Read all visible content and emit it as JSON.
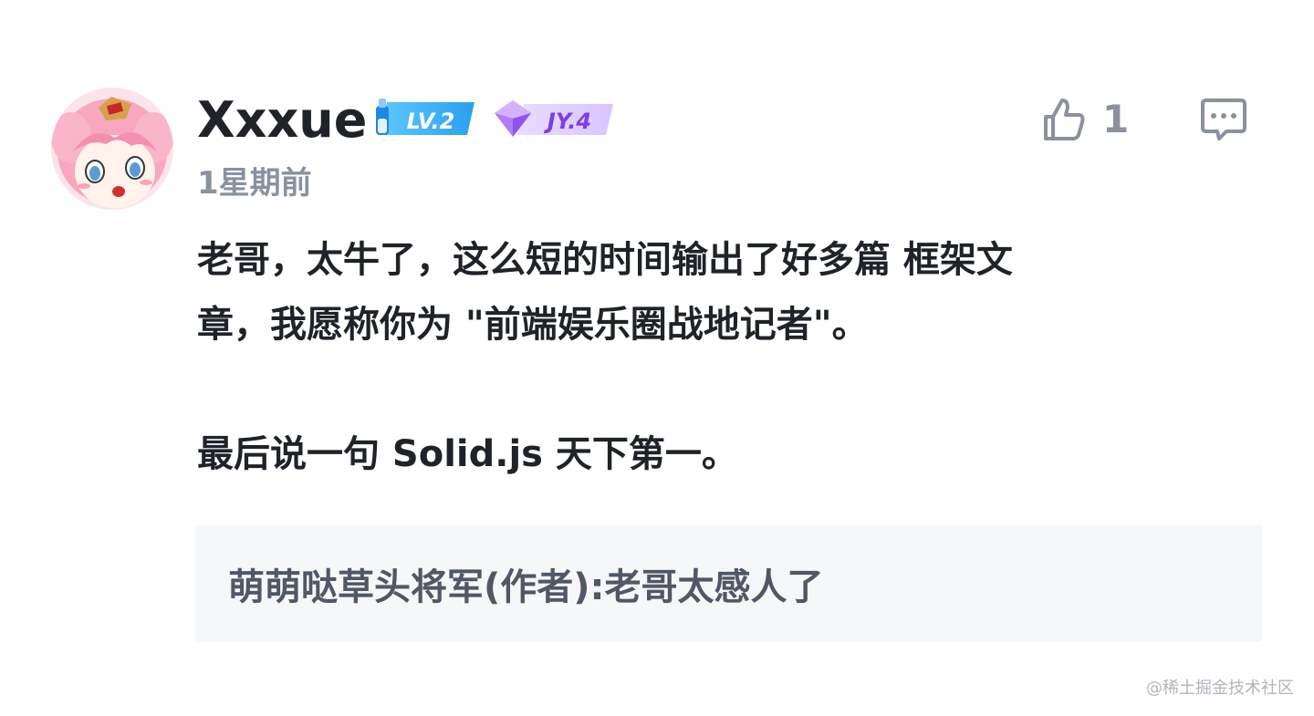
{
  "comment": {
    "username": "Xxxue",
    "badges": {
      "level": "LV.2",
      "jy": "JY.4"
    },
    "timestamp": "1星期前",
    "like_count": "1",
    "content": {
      "line1": "老哥，太牛了，这么短的时间输出了好多篇 框架文",
      "line2": "章，我愿称你为 \"前端娱乐圈战地记者\"。",
      "line3": "最后说一句 Solid.js 天下第一。"
    },
    "reply": "萌萌哒草头将军(作者):老哥太感人了",
    "icons": {
      "like": "thumbs-up-icon",
      "comment": "comment-icon"
    }
  },
  "watermark": "@稀土掘金技术社区",
  "colors": {
    "text_primary": "#1f2329",
    "text_secondary": "#8a919f",
    "reply_bg": "#f6f7f9",
    "level_badge": "#3aa7f5",
    "jy_badge": "#a36cf6"
  }
}
